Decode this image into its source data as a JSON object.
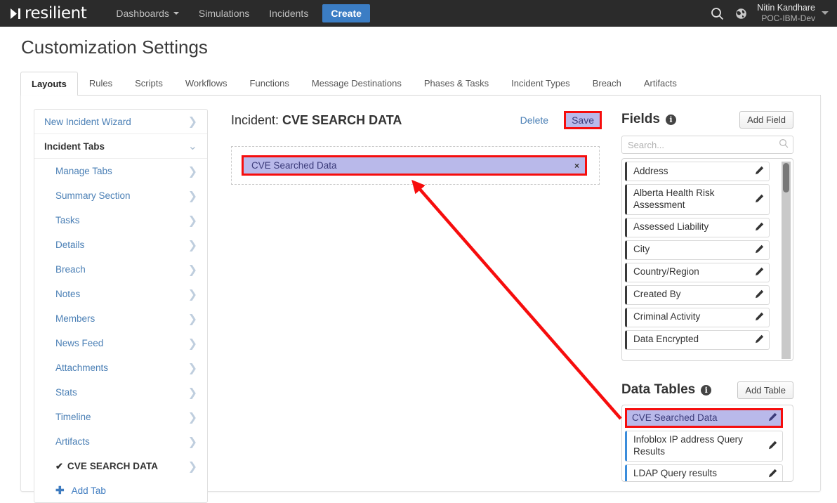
{
  "topnav": {
    "logo_text": "resilient",
    "logo_icon": "chevron-mark-logo",
    "items": [
      {
        "label": "Dashboards",
        "has_caret": true
      },
      {
        "label": "Simulations",
        "has_caret": false
      },
      {
        "label": "Incidents",
        "has_caret": false
      }
    ],
    "create_label": "Create",
    "search_icon": "search-icon",
    "globe_icon": "globe-icon",
    "user_name": "Nitin Kandhare",
    "user_org": "POC-IBM-Dev"
  },
  "page": {
    "title": "Customization Settings"
  },
  "tabs": [
    {
      "label": "Layouts",
      "active": true
    },
    {
      "label": "Rules",
      "active": false
    },
    {
      "label": "Scripts",
      "active": false
    },
    {
      "label": "Workflows",
      "active": false
    },
    {
      "label": "Functions",
      "active": false
    },
    {
      "label": "Message Destinations",
      "active": false
    },
    {
      "label": "Phases & Tasks",
      "active": false
    },
    {
      "label": "Incident Types",
      "active": false
    },
    {
      "label": "Breach",
      "active": false
    },
    {
      "label": "Artifacts",
      "active": false
    }
  ],
  "sidebar": {
    "items": [
      {
        "label": "New Incident Wizard",
        "type": "top",
        "chevron": "chevron-right-icon"
      },
      {
        "label": "Incident Tabs",
        "type": "header",
        "chevron": "chevron-down-icon"
      },
      {
        "label": "Manage Tabs",
        "type": "sub",
        "chevron": "chevron-right-icon"
      },
      {
        "label": "Summary Section",
        "type": "sub",
        "chevron": "chevron-right-icon"
      },
      {
        "label": "Tasks",
        "type": "sub",
        "chevron": "chevron-right-icon"
      },
      {
        "label": "Details",
        "type": "sub",
        "chevron": "chevron-right-icon"
      },
      {
        "label": "Breach",
        "type": "sub",
        "chevron": "chevron-right-icon"
      },
      {
        "label": "Notes",
        "type": "sub",
        "chevron": "chevron-right-icon"
      },
      {
        "label": "Members",
        "type": "sub",
        "chevron": "chevron-right-icon"
      },
      {
        "label": "News Feed",
        "type": "sub",
        "chevron": "chevron-right-icon"
      },
      {
        "label": "Attachments",
        "type": "sub",
        "chevron": "chevron-right-icon"
      },
      {
        "label": "Stats",
        "type": "sub",
        "chevron": "chevron-right-icon"
      },
      {
        "label": "Timeline",
        "type": "sub",
        "chevron": "chevron-right-icon"
      },
      {
        "label": "Artifacts",
        "type": "sub",
        "chevron": "chevron-right-icon"
      },
      {
        "label": "CVE SEARCH DATA",
        "type": "selected-sub",
        "chevron": "chevron-right-icon",
        "check": "✔"
      }
    ],
    "add_tab_label": "Add Tab",
    "add_tab_icon": "plus-icon"
  },
  "center": {
    "title_prefix": "Incident: ",
    "title_name": "CVE SEARCH DATA",
    "delete_label": "Delete",
    "save_label": "Save",
    "dropzone_item": "CVE Searched Data",
    "dropzone_close_icon": "×"
  },
  "fields": {
    "heading": "Fields",
    "info_icon": "info-icon",
    "add_label": "Add Field",
    "search_placeholder": "Search...",
    "search_value": "",
    "search_icon": "search-icon",
    "items": [
      {
        "label": "Address",
        "edit_icon": "pencil-icon"
      },
      {
        "label": "Alberta Health Risk Assessment",
        "edit_icon": "pencil-icon"
      },
      {
        "label": "Assessed Liability",
        "edit_icon": "pencil-icon"
      },
      {
        "label": "City",
        "edit_icon": "pencil-icon"
      },
      {
        "label": "Country/Region",
        "edit_icon": "pencil-icon"
      },
      {
        "label": "Created By",
        "edit_icon": "pencil-icon"
      },
      {
        "label": "Criminal Activity",
        "edit_icon": "pencil-icon"
      },
      {
        "label": "Data Encrypted",
        "edit_icon": "pencil-icon"
      }
    ]
  },
  "data_tables": {
    "heading": "Data Tables",
    "info_icon": "info-icon",
    "add_label": "Add Table",
    "items": [
      {
        "label": "CVE Searched Data",
        "edit_icon": "pencil-icon",
        "selected": true
      },
      {
        "label": "Infoblox IP address Query Results",
        "edit_icon": "pencil-icon",
        "selected": false
      },
      {
        "label": "LDAP Query results",
        "edit_icon": "pencil-icon",
        "selected": false
      }
    ]
  },
  "annotations": {
    "highlight_color": "#f60d0d",
    "arrow_from": "cve-searched-data-table-item",
    "arrow_to": "incident-tab-dropzone"
  }
}
